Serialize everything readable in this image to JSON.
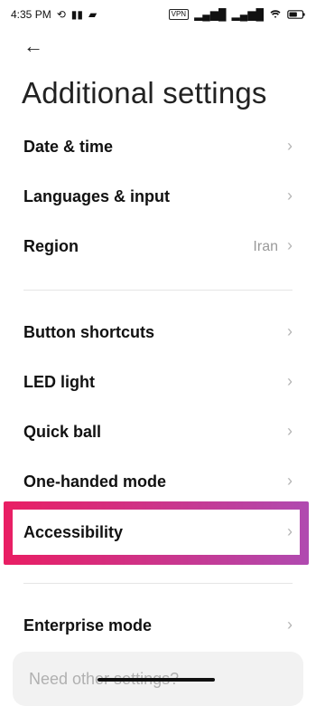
{
  "status_bar": {
    "time": "4:35 PM",
    "left_icons": [
      "sync-off-icon",
      "signal-icon",
      "notification-icon"
    ],
    "vpn": "VPN",
    "right_icons": [
      "signal-1-icon",
      "signal-2-icon",
      "wifi-icon",
      "battery-icon"
    ]
  },
  "header": {
    "back_icon": "back-arrow-icon",
    "title": "Additional settings"
  },
  "settings": {
    "group1": [
      {
        "label": "Date & time",
        "value": ""
      },
      {
        "label": "Languages & input",
        "value": ""
      },
      {
        "label": "Region",
        "value": "Iran"
      }
    ],
    "group2": [
      {
        "label": "Button shortcuts",
        "value": ""
      },
      {
        "label": "LED light",
        "value": ""
      },
      {
        "label": "Quick ball",
        "value": ""
      },
      {
        "label": "One-handed mode",
        "value": ""
      }
    ],
    "highlighted": {
      "label": "Accessibility",
      "value": ""
    },
    "group3": [
      {
        "label": "Enterprise mode",
        "value": ""
      }
    ]
  },
  "bottom_card": {
    "text": "Need other settings?"
  },
  "colors": {
    "highlight_start": "#e91e63",
    "highlight_end": "#b04ab0",
    "chevron": "#b5b5b5"
  }
}
